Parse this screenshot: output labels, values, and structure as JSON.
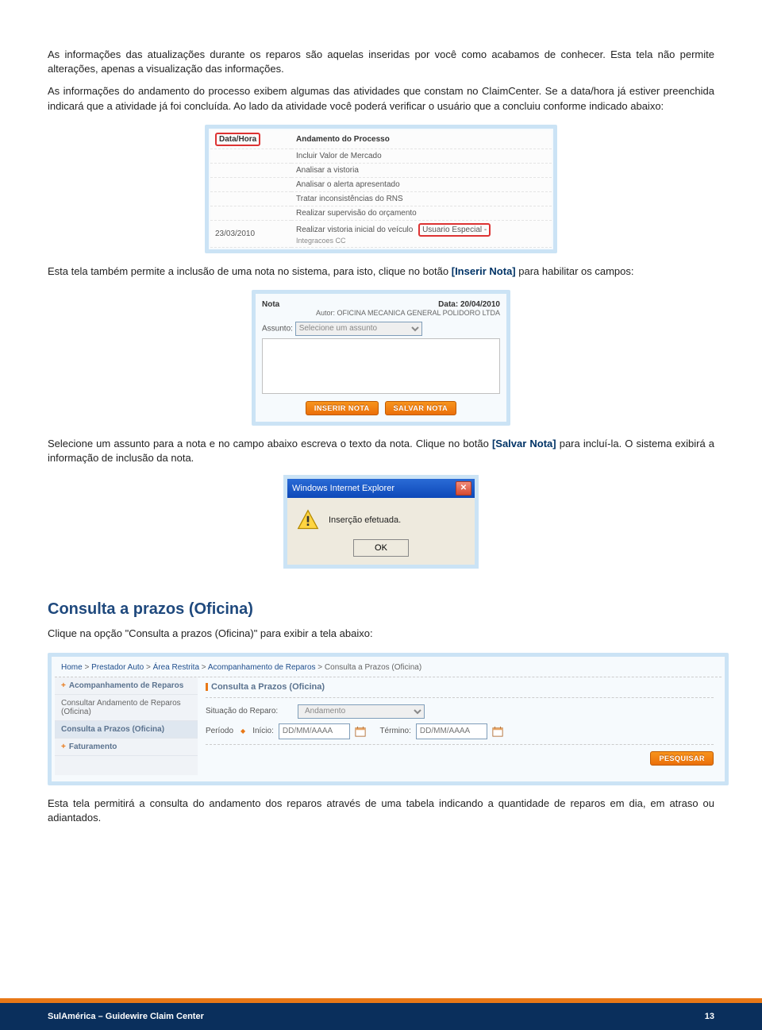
{
  "para1": "As informações das atualizações durante os reparos são aquelas inseridas por você como acabamos de conhecer. Esta tela não permite alterações, apenas a visualização das informações.",
  "para2": "As informações do andamento do processo exibem algumas das atividades que constam no ClaimCenter. Se a data/hora já estiver preenchida indicará que a atividade já foi concluída. Ao lado da atividade você poderá verificar o usuário que a concluiu conforme indicado abaixo:",
  "fig1": {
    "col1": "Data/Hora",
    "col2": "Andamento do Processo",
    "rows": [
      "Incluir Valor de Mercado",
      "Analisar a vistoria",
      "Analisar o alerta apresentado",
      "Tratar inconsistências do RNS",
      "Realizar supervisão do orçamento"
    ],
    "lastDate": "23/03/2010",
    "lastAct": "Realizar vistoria inicial do veículo",
    "lastUser": "Usuario Especial -",
    "lastSub": "Integracoes CC"
  },
  "para3_a": "Esta tela também permite a inclusão de uma nota no sistema, para isto, clique no botão ",
  "para3_link": "[Inserir Nota]",
  "para3_b": " para habilitar os campos:",
  "fig2": {
    "notaLbl": "Nota",
    "dataLbl": "Data: 20/04/2010",
    "autor": "Autor: OFICINA MECANICA GENERAL POLIDORO LTDA",
    "assuntoLbl": "Assunto:",
    "assuntoPh": "Selecione um assunto",
    "btnInserir": "INSERIR NOTA",
    "btnSalvar": "SALVAR NOTA"
  },
  "para4_a": "Selecione um assunto para a nota e no campo abaixo escreva o texto da nota. Clique no botão ",
  "para4_link": "[Salvar Nota]",
  "para4_b": " para incluí-la. O sistema exibirá a informação de inclusão da nota.",
  "fig3": {
    "title": "Windows Internet Explorer",
    "msg": "Inserção efetuada.",
    "ok": "OK"
  },
  "section": "Consulta a prazos (Oficina)",
  "para5": "Clique na opção \"Consulta a prazos (Oficina)\" para exibir a tela abaixo:",
  "fig4": {
    "crumbs": [
      "Home",
      "Prestador Auto",
      "Área Restrita",
      "Acompanhamento de Reparos",
      "Consulta a Prazos (Oficina)"
    ],
    "nav": {
      "parent1": "Acompanhamento de Reparos",
      "sub1": "Consultar Andamento de Reparos (Oficina)",
      "sub2": "Consulta a Prazos (Oficina)",
      "parent2": "Faturamento"
    },
    "panelTitle": "Consulta a Prazos (Oficina)",
    "sitLbl": "Situação do Reparo:",
    "sitVal": "Andamento",
    "periodoLbl": "Período",
    "inicioLbl": "Início:",
    "terminoLbl": "Término:",
    "datePh": "DD/MM/AAAA",
    "search": "PESQUISAR"
  },
  "para6": "Esta tela permitirá a consulta do andamento dos reparos através de uma tabela indicando a quantidade de reparos em dia, em atraso ou adiantados.",
  "footerL": "SulAmérica – Guidewire Claim Center",
  "footerR": "13"
}
